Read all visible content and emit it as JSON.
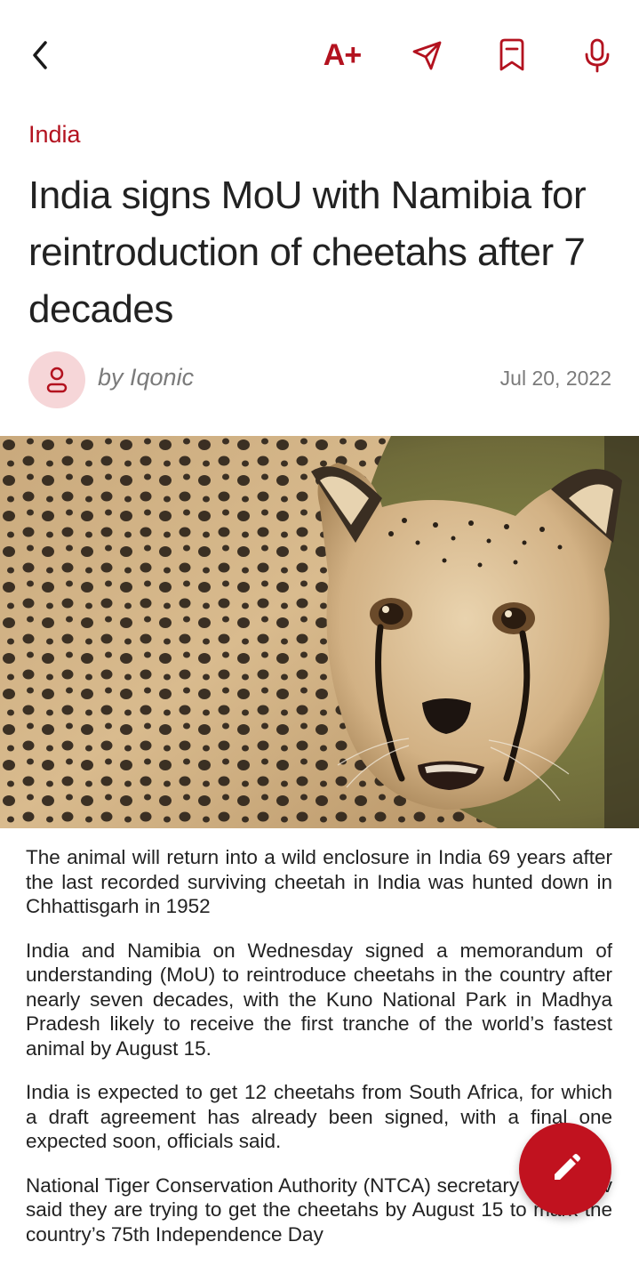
{
  "toolbar": {
    "back_icon": "chevron-left-icon",
    "font_size_label": "A+",
    "share_icon": "send-icon",
    "bookmark_icon": "bookmark-icon",
    "mic_icon": "microphone-icon"
  },
  "article": {
    "category": "India",
    "title": "India signs MoU with Namibia for reintroduction of cheetahs after 7 decades",
    "author": "by Iqonic",
    "date": "Jul 20, 2022",
    "paragraphs": [
      "The animal will return into a wild enclosure in India 69 years after the last recorded surviving cheetah in India was hunted down in Chhattisgarh in 1952",
      "India and Namibia on Wednesday signed a memorandum of understanding (MoU) to reintroduce cheetahs in the country after nearly seven decades, with the Kuno National Park in Madhya Pradesh likely to receive the first tranche of the world’s fastest animal by August 15.",
      "India is expected to get 12 cheetahs from South Africa, for which a draft agreement has already been signed, with a final one expected soon, officials said.",
      "National Tiger Conservation Authority (NTCA) secretary SP Yadav said they are trying to get the cheetahs by August 15 to mark the country’s 75th Independence Day"
    ]
  },
  "fab": {
    "icon": "pencil-icon"
  },
  "colors": {
    "accent": "#b3121f",
    "avatar_bg": "#f6d6d8",
    "fab": "#c1121f"
  }
}
